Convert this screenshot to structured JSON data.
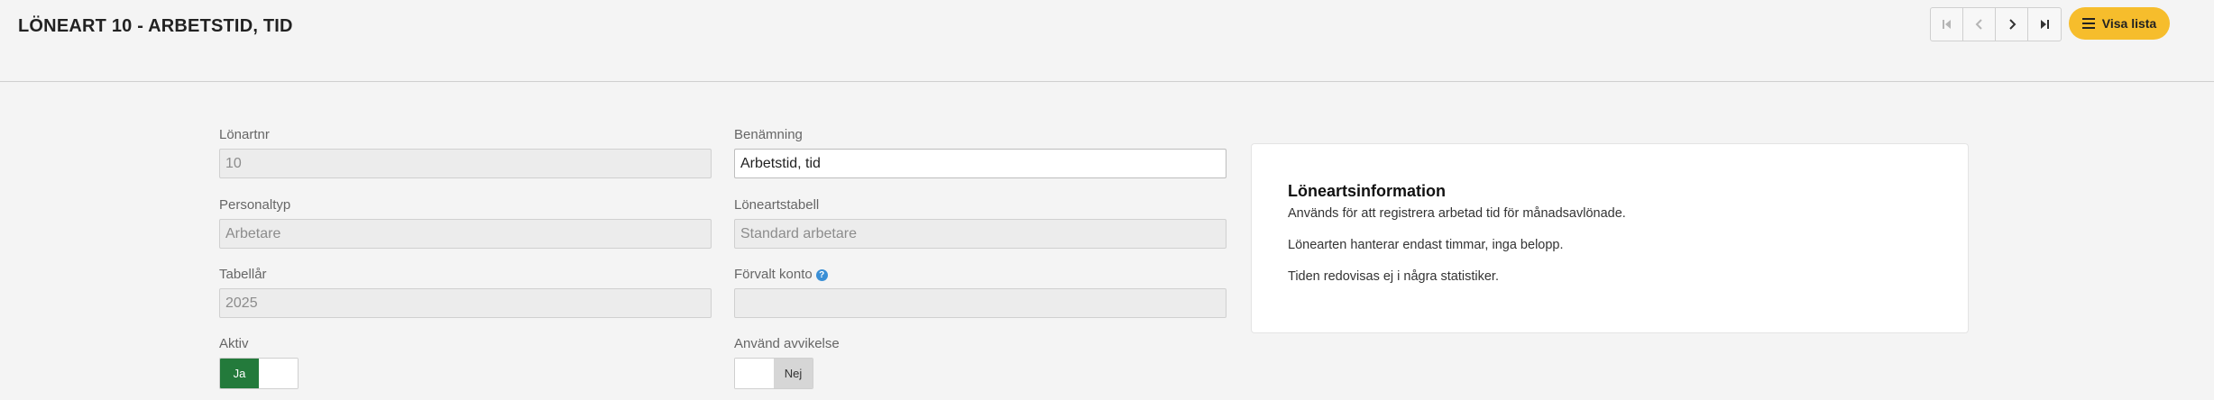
{
  "header": {
    "title": "LÖNEART 10 - ARBETSTID, TID",
    "visa_lista_label": "Visa lista",
    "nav_icons": [
      "first-page-icon",
      "previous-icon",
      "next-icon",
      "last-page-icon"
    ]
  },
  "form": {
    "lonartnr": {
      "label": "Lönartnr",
      "value": "10"
    },
    "benamning": {
      "label": "Benämning",
      "value": "Arbetstid, tid"
    },
    "personaltyp": {
      "label": "Personaltyp",
      "value": "Arbetare"
    },
    "loneartstabell": {
      "label": "Löneartstabell",
      "value": "Standard arbetare"
    },
    "tabellar": {
      "label": "Tabellår",
      "value": "2025"
    },
    "forvalt_konto": {
      "label": "Förvalt konto",
      "value": ""
    },
    "aktiv": {
      "label": "Aktiv",
      "on_label": "Ja",
      "selected": "Ja"
    },
    "anvand_avvikelse": {
      "label": "Använd avvikelse",
      "off_label": "Nej",
      "selected": "Nej"
    }
  },
  "info": {
    "title": "Löneartsinformation",
    "lines": [
      "Används för att registrera arbetad tid för månadsavlönade.",
      "Lönearten hanterar endast timmar, inga belopp.",
      "Tiden redovisas ej i några statistiker."
    ]
  },
  "colors": {
    "accent_yellow": "#f6bd2c",
    "toggle_green": "#237a3b",
    "help_blue": "#3a8fd6"
  }
}
